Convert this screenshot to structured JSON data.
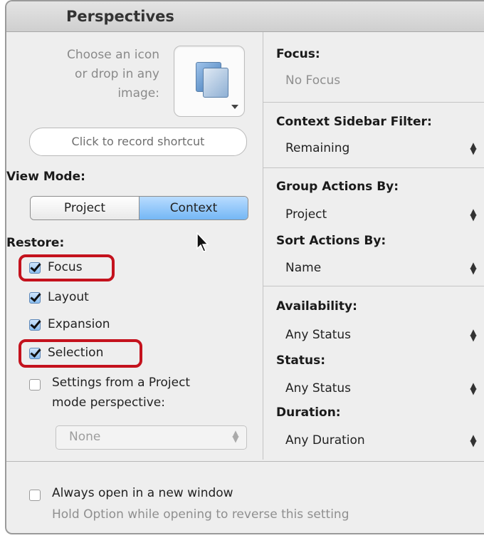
{
  "window": {
    "title": "Perspectives"
  },
  "left": {
    "icon_prompt": [
      "Choose an icon",
      "or drop in any",
      "image:"
    ],
    "shortcut_label": "Click to record shortcut",
    "view_mode": {
      "label": "View Mode:",
      "options": [
        "Project",
        "Context"
      ],
      "selected": "Context"
    },
    "restore": {
      "label": "Restore:",
      "items": [
        {
          "label": "Focus",
          "checked": true,
          "highlighted": true
        },
        {
          "label": "Layout",
          "checked": true,
          "highlighted": false
        },
        {
          "label": "Expansion",
          "checked": true,
          "highlighted": false
        },
        {
          "label": "Selection",
          "checked": true,
          "highlighted": true
        }
      ],
      "settings_from": {
        "label_line1": "Settings from a Project",
        "label_line2": "mode perspective:",
        "checked": false
      },
      "perspective_popup": {
        "value": "None",
        "enabled": false
      }
    }
  },
  "right": {
    "focus": {
      "label": "Focus:",
      "value": "No Focus"
    },
    "context_filter": {
      "label": "Context Sidebar Filter:",
      "value": "Remaining"
    },
    "group_by": {
      "label": "Group Actions By:",
      "value": "Project"
    },
    "sort_by": {
      "label": "Sort Actions By:",
      "value": "Name"
    },
    "availability": {
      "label": "Availability:",
      "value": "Any Status"
    },
    "status": {
      "label": "Status:",
      "value": "Any Status"
    },
    "duration": {
      "label": "Duration:",
      "value": "Any Duration"
    }
  },
  "footer": {
    "new_window": {
      "label": "Always open in a new window",
      "checked": false
    },
    "hint": "Hold Option while opening to reverse this setting"
  },
  "colors": {
    "highlight": "#c4121d",
    "selected_segment": "#74b7f5"
  }
}
